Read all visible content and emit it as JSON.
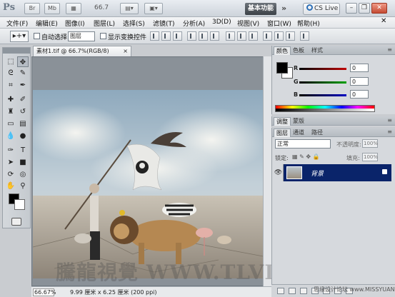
{
  "titlebar": {
    "app_logo": "Ps",
    "zoom": "66.7",
    "workspace": "基本功能",
    "more": "»",
    "cs_live": "CS Live",
    "buttons": [
      "minimize-icon",
      "restore-icon",
      "close-icon"
    ]
  },
  "menu": [
    "文件(F)",
    "编辑(E)",
    "图像(I)",
    "图层(L)",
    "选择(S)",
    "滤镜(T)",
    "分析(A)",
    "3D(D)",
    "视图(V)",
    "窗口(W)",
    "帮助(H)"
  ],
  "options": {
    "auto_select_label": "自动选择:",
    "auto_select_value": "图层",
    "show_transform_label": "显示变换控件"
  },
  "document": {
    "tab_title": "素材1.tif @ 66.7%(RGB/8)",
    "status_zoom": "66.67%",
    "status_info": "9.99 厘米 x 6.25 厘米 (200 ppi)",
    "watermark": "騰龍視覺 WWW.TLVI.NET"
  },
  "color_panel": {
    "tabs": [
      "颜色",
      "色板",
      "样式"
    ],
    "sliders": [
      {
        "label": "R",
        "value": "0",
        "color": "#c00000"
      },
      {
        "label": "G",
        "value": "0",
        "color": "#00a000"
      },
      {
        "label": "B",
        "value": "0",
        "color": "#0000c0"
      }
    ]
  },
  "adjust_panel": {
    "tabs": [
      "调整",
      "蒙版"
    ]
  },
  "layers_panel": {
    "tabs": [
      "图层",
      "通道",
      "路径"
    ],
    "blend_mode": "正常",
    "opacity_label": "不透明度:",
    "opacity_value": "100%",
    "lock_label": "锁定:",
    "fill_label": "填充:",
    "fill_value": "100%",
    "layer_name": "背景"
  },
  "site_mark": "思缘设计论坛  www.MISSYUAN.COM"
}
